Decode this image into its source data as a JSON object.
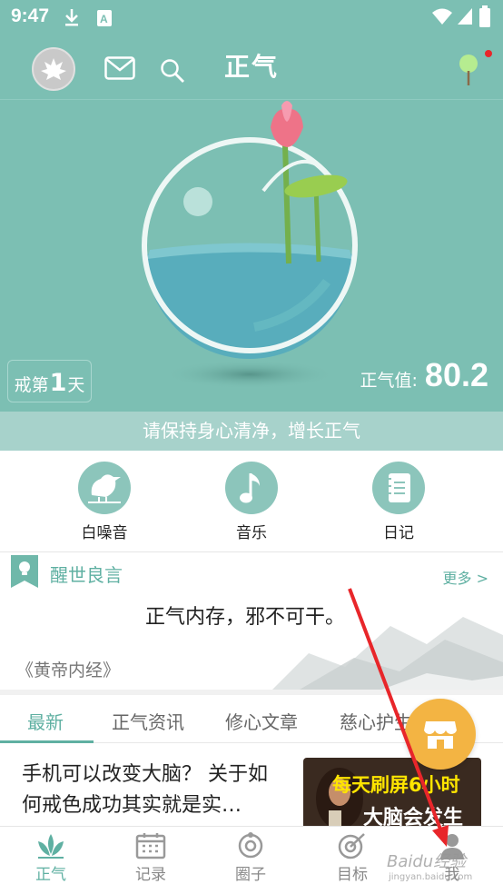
{
  "status_bar": {
    "time": "9:47"
  },
  "header": {
    "title": "正气"
  },
  "stats": {
    "streak_prefix": "戒第",
    "streak_days": "1",
    "streak_suffix": "天",
    "score_label": "正气值:",
    "score_value": "80.2"
  },
  "banner": {
    "text": "请保持身心清净，增长正气"
  },
  "quick_actions": [
    {
      "label": "白噪音",
      "icon": "bird-icon"
    },
    {
      "label": "音乐",
      "icon": "music-note-icon"
    },
    {
      "label": "日记",
      "icon": "notebook-icon"
    }
  ],
  "quote": {
    "section_title": "醒世良言",
    "more_label": "更多 >",
    "text": "正气内存，邪不可干。",
    "source": "《黄帝内经》"
  },
  "tabs": [
    {
      "label": "最新",
      "active": true
    },
    {
      "label": "正气资讯",
      "active": false
    },
    {
      "label": "修心文章",
      "active": false
    },
    {
      "label": "慈心护生",
      "active": false
    }
  ],
  "article": {
    "title": "手机可以改变大脑？ 关于如何戒色成功其实就是实…",
    "thumb_line1": "每天刷屏6小时",
    "thumb_line2": "大脑会发生"
  },
  "bottom_nav": [
    {
      "label": "正气",
      "active": true
    },
    {
      "label": "记录",
      "active": false
    },
    {
      "label": "圈子",
      "active": false
    },
    {
      "label": "目标",
      "active": false
    },
    {
      "label": "我",
      "active": false
    }
  ],
  "watermark": {
    "text": "Baidu经验",
    "sub": "jingyan.baidu.com"
  },
  "colors": {
    "teal": "#7cbfb3",
    "accent": "#5fb0a2",
    "fab": "#f3b443",
    "arrow": "#e8262a"
  }
}
